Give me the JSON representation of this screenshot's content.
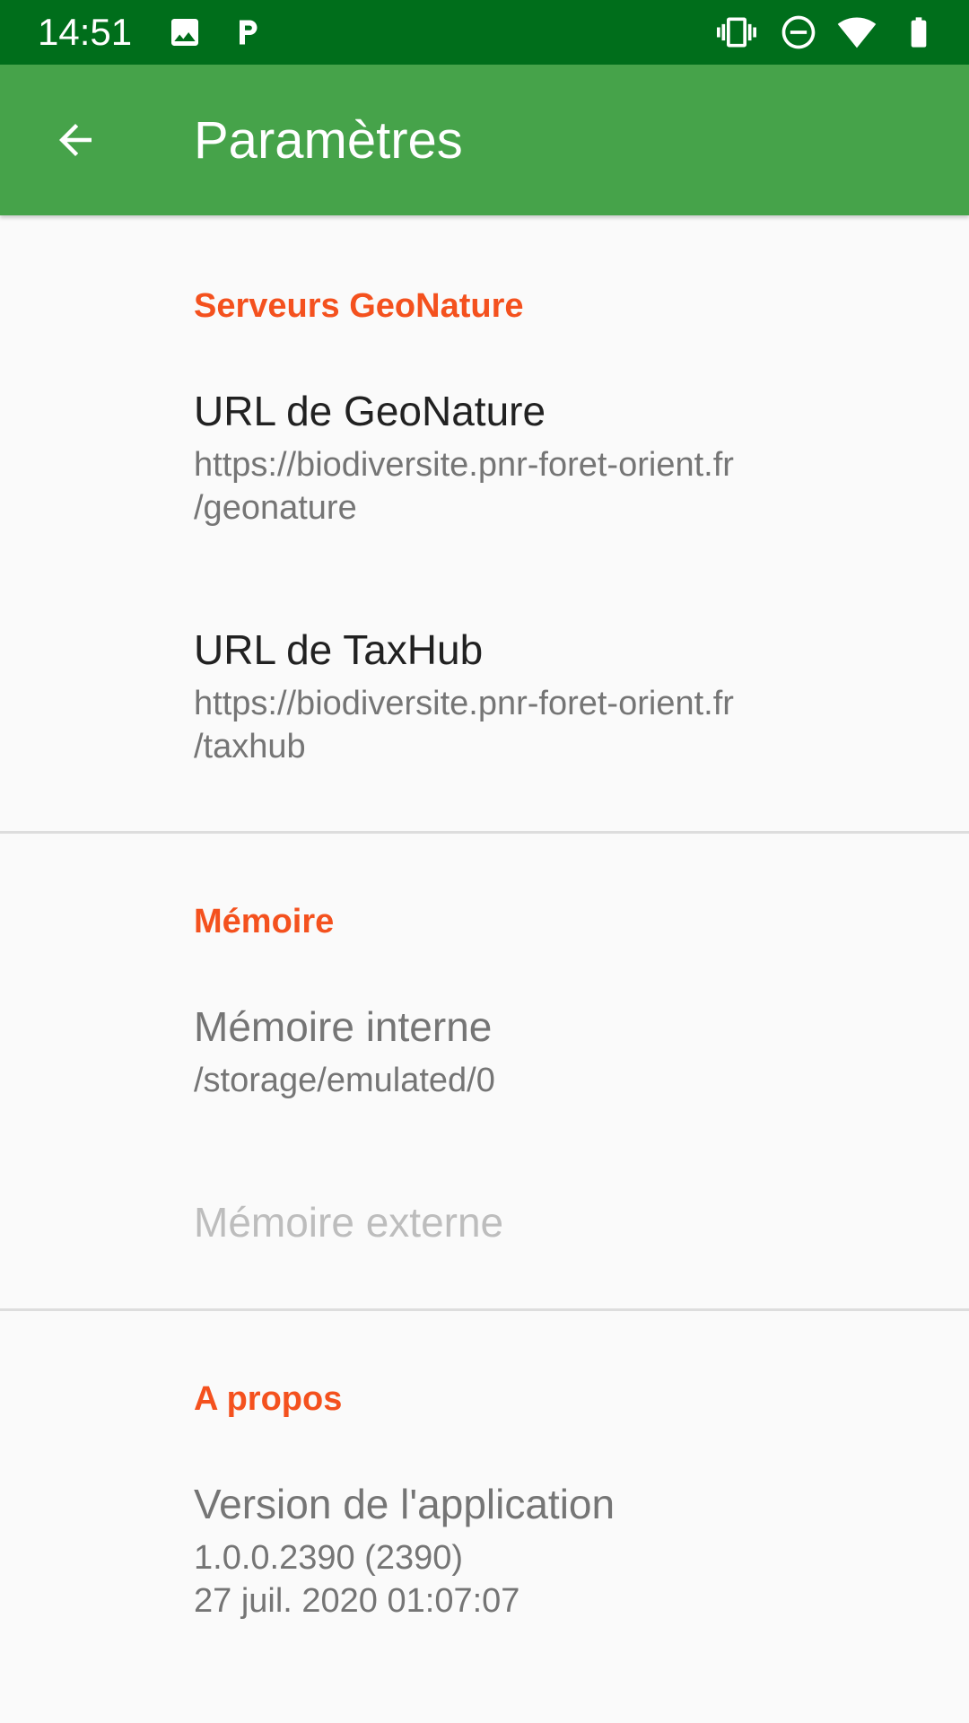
{
  "status_bar": {
    "time": "14:51",
    "left_icons": [
      "image-icon",
      "parking-p-icon"
    ],
    "right_icons": [
      "vibrate-icon",
      "do-not-disturb-icon",
      "wifi-icon",
      "battery-icon"
    ],
    "color": "#006e1b"
  },
  "app_bar": {
    "title": "Paramètres",
    "back_icon": "arrow-back-icon",
    "color": "#46a34a"
  },
  "sections": {
    "servers": {
      "title": "Serveurs GeoNature",
      "items": [
        {
          "title": "URL de GeoNature",
          "summary": "https://biodiversite.pnr-foret-orient.fr\n/geonature"
        },
        {
          "title": "URL de TaxHub",
          "summary": "https://biodiversite.pnr-foret-orient.fr\n/taxhub"
        }
      ]
    },
    "memory": {
      "title": "Mémoire",
      "items": [
        {
          "title": "Mémoire interne",
          "summary": "/storage/emulated/0"
        },
        {
          "title": "Mémoire externe"
        }
      ]
    },
    "about": {
      "title": "A propos",
      "items": [
        {
          "title": "Version de l'application",
          "summary": "1.0.0.2390 (2390)\n27 juil. 2020 01:07:07"
        }
      ]
    }
  },
  "colors": {
    "accent": "#f4511e",
    "background": "#fafafa",
    "primary_text": "#212121",
    "secondary_text": "#757575",
    "disabled_text": "#bdbdbd"
  }
}
